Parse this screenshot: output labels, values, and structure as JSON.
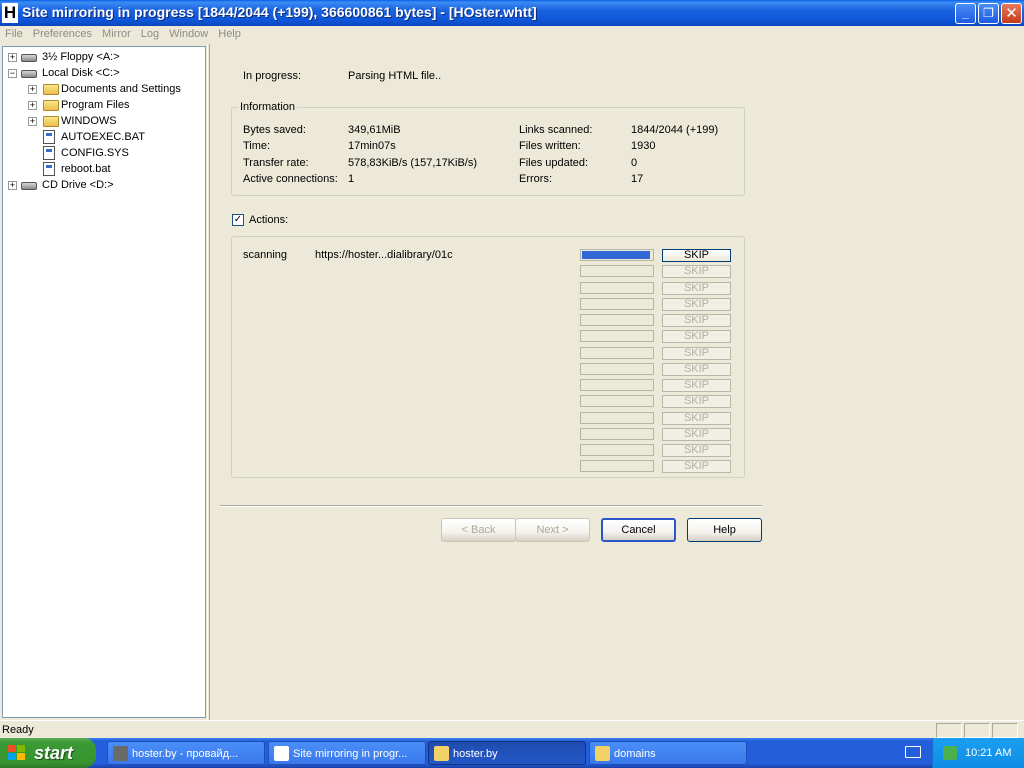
{
  "window": {
    "icon_letter": "H",
    "title": "Site mirroring in progress [1844/2044 (+199), 366600861 bytes] - [HOster.whtt]",
    "btn_min": "_",
    "btn_max": "❐",
    "btn_close": "✕"
  },
  "menu": [
    "File",
    "Preferences",
    "Mirror",
    "Log",
    "Window",
    "Help"
  ],
  "tree": [
    {
      "label": "3½ Floppy <A:>",
      "icon": "floppy-drive-icon",
      "expander": "+"
    },
    {
      "label": "Local Disk <C:>",
      "icon": "hard-drive-icon",
      "expander": "−"
    },
    {
      "label": "Documents and Settings",
      "icon": "folder-icon",
      "expander": "+"
    },
    {
      "label": "Program Files",
      "icon": "folder-icon",
      "expander": "+"
    },
    {
      "label": "WINDOWS",
      "icon": "folder-icon",
      "expander": "+"
    },
    {
      "label": "AUTOEXEC.BAT",
      "icon": "batch-file-icon",
      "expander": ""
    },
    {
      "label": "CONFIG.SYS",
      "icon": "system-file-icon",
      "expander": ""
    },
    {
      "label": "reboot.bat",
      "icon": "batch-file-icon",
      "expander": ""
    },
    {
      "label": "CD Drive <D:>",
      "icon": "cd-drive-icon",
      "expander": "+"
    }
  ],
  "progress": {
    "label": "In progress:",
    "value": "Parsing HTML file.."
  },
  "information": {
    "title": "Information",
    "left": [
      {
        "label": "Bytes saved:",
        "value": "349,61MiB"
      },
      {
        "label": "Time:",
        "value": "17min07s"
      },
      {
        "label": "Transfer rate:",
        "value": "578,83KiB/s (157,17KiB/s)"
      },
      {
        "label": "Active connections:",
        "value": "1"
      }
    ],
    "right": [
      {
        "label": "Links scanned:",
        "value": "1844/2044 (+199)"
      },
      {
        "label": "Files written:",
        "value": "1930"
      },
      {
        "label": "Files updated:",
        "value": "0"
      },
      {
        "label": "Errors:",
        "value": "17"
      }
    ]
  },
  "actions": {
    "checkbox_label": "Actions:",
    "checked": true,
    "check_mark": "✓",
    "rows": [
      {
        "status": "scanning",
        "url": "https://hoster...dialibrary/01c",
        "progress": 0.97,
        "skip": "SKIP",
        "active": true
      },
      {
        "status": "",
        "url": "",
        "progress": 0,
        "skip": "SKIP",
        "active": false
      },
      {
        "status": "",
        "url": "",
        "progress": 0,
        "skip": "SKIP",
        "active": false
      },
      {
        "status": "",
        "url": "",
        "progress": 0,
        "skip": "SKIP",
        "active": false
      },
      {
        "status": "",
        "url": "",
        "progress": 0,
        "skip": "SKIP",
        "active": false
      },
      {
        "status": "",
        "url": "",
        "progress": 0,
        "skip": "SKIP",
        "active": false
      },
      {
        "status": "",
        "url": "",
        "progress": 0,
        "skip": "SKIP",
        "active": false
      },
      {
        "status": "",
        "url": "",
        "progress": 0,
        "skip": "SKIP",
        "active": false
      },
      {
        "status": "",
        "url": "",
        "progress": 0,
        "skip": "SKIP",
        "active": false
      },
      {
        "status": "",
        "url": "",
        "progress": 0,
        "skip": "SKIP",
        "active": false
      },
      {
        "status": "",
        "url": "",
        "progress": 0,
        "skip": "SKIP",
        "active": false
      },
      {
        "status": "",
        "url": "",
        "progress": 0,
        "skip": "SKIP",
        "active": false
      },
      {
        "status": "",
        "url": "",
        "progress": 0,
        "skip": "SKIP",
        "active": false
      },
      {
        "status": "",
        "url": "",
        "progress": 0,
        "skip": "SKIP",
        "active": false
      }
    ]
  },
  "buttons": {
    "back": "< Back",
    "next": "Next >",
    "cancel": "Cancel",
    "help": "Help"
  },
  "status": "Ready",
  "taskbar": {
    "start": "start",
    "tasks": [
      {
        "label": "hoster.by - провайд...",
        "icon": "browser-icon",
        "active": false
      },
      {
        "label": "Site mirroring in progr...",
        "icon": "httrack-icon",
        "active": false
      },
      {
        "label": "hoster.by",
        "icon": "folder-icon",
        "active": true
      },
      {
        "label": "domains",
        "icon": "folder-icon",
        "active": false
      }
    ],
    "clock": "10:21 AM"
  },
  "colors": {
    "titlebar": "#0a5ee8",
    "progress_fill": "#3168d5",
    "taskbar": "#245edb",
    "start": "#3c9a34"
  }
}
